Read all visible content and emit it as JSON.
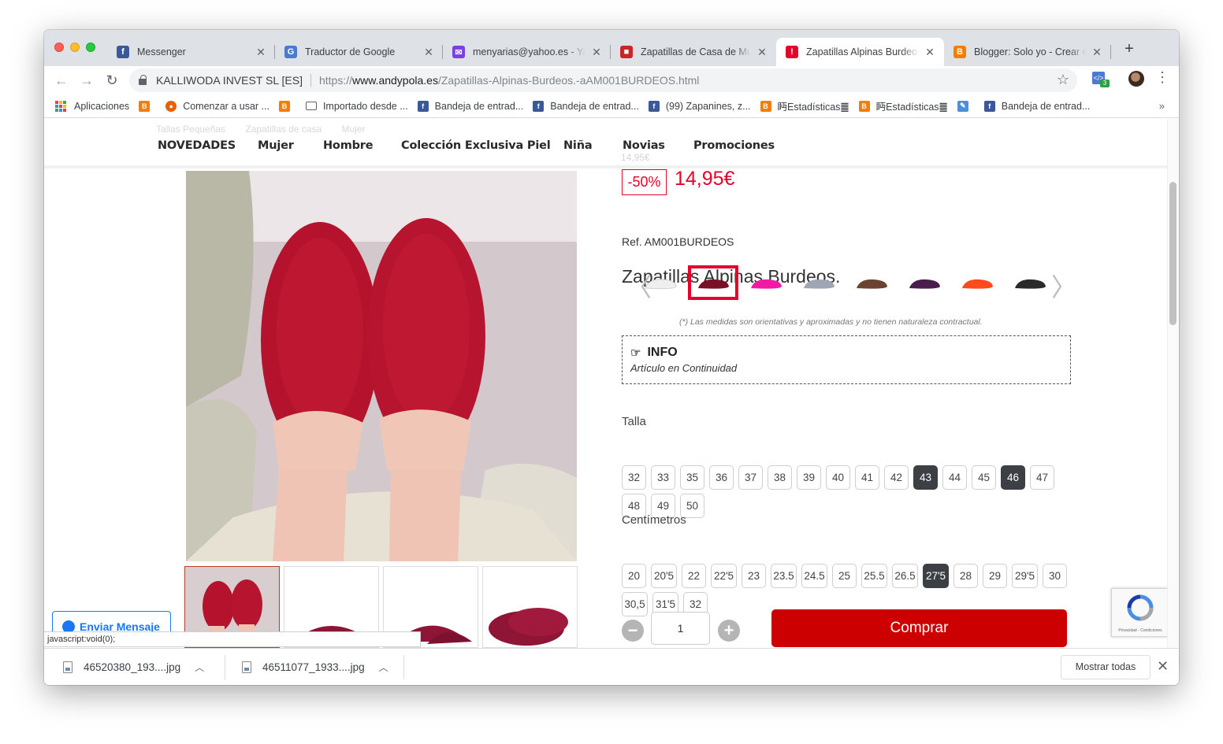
{
  "browser": {
    "tabs": [
      {
        "title": "Messenger",
        "favicon": "facebook-icon",
        "color": "#3b5998",
        "glyph": "f"
      },
      {
        "title": "Traductor de Google",
        "favicon": "google-translate-icon",
        "color": "#4a7bd0",
        "glyph": "G"
      },
      {
        "title": "menyarias@yahoo.es - Yahoo",
        "favicon": "yahoo-mail-icon",
        "color": "#7b3fe4",
        "glyph": "✉"
      },
      {
        "title": "Zapatillas de Casa de Mujer",
        "favicon": "store-icon",
        "color": "#c62828",
        "glyph": "■"
      },
      {
        "title": "Zapatillas Alpinas Burdeos",
        "favicon": "andypola-icon",
        "color": "#e4002b",
        "glyph": "!"
      },
      {
        "title": "Blogger: Solo yo - Crear en",
        "favicon": "blogger-icon",
        "color": "#f57d00",
        "glyph": "B"
      }
    ],
    "address": {
      "org": "KALLIWODA INVEST SL [ES]",
      "scheme": "https://",
      "host": "www.andypola.es",
      "path": "/Zapatillas-Alpinas-Burdeos.-aAM001BURDEOS.html"
    },
    "extension_badge": "3",
    "bookmarks": [
      {
        "label": "Aplicaciones",
        "icon": "apps-grid-icon"
      },
      {
        "label": "",
        "icon": "blogger-icon",
        "color": "#f57d00",
        "glyph": "B"
      },
      {
        "label": "Comenzar a usar ...",
        "icon": "firefox-icon",
        "color": "#e66000",
        "glyph": "●"
      },
      {
        "label": "",
        "icon": "blogger-icon",
        "color": "#f57d00",
        "glyph": "B"
      },
      {
        "label": "Importado desde ...",
        "icon": "folder-icon",
        "color": "#ffffff",
        "glyph": ""
      },
      {
        "label": "Bandeja de entrad...",
        "icon": "facebook-icon",
        "color": "#3b5998",
        "glyph": "f"
      },
      {
        "label": "Bandeja de entrad...",
        "icon": "facebook-icon",
        "color": "#3b5998",
        "glyph": "f"
      },
      {
        "label": "(99) Zapanines, z...",
        "icon": "facebook-icon",
        "color": "#3b5998",
        "glyph": "f"
      },
      {
        "label": "眄Estadísticas䷀",
        "icon": "blogger-icon",
        "color": "#f57d00",
        "glyph": "B"
      },
      {
        "label": "眄Estadísticas䷀",
        "icon": "blogger-icon",
        "color": "#f57d00",
        "glyph": "B"
      },
      {
        "label": "",
        "icon": "bookmark-script-icon",
        "color": "#4a90d9",
        "glyph": "✎"
      },
      {
        "label": "Bandeja de entrad...",
        "icon": "facebook-icon",
        "color": "#3b5998",
        "glyph": "f"
      }
    ],
    "status_url": "javascript:void(0);",
    "downloads": [
      {
        "file": "46520380_193....jpg"
      },
      {
        "file": "46511077_1933....jpg"
      }
    ],
    "show_all": "Mostrar todas"
  },
  "site": {
    "ghost_breadcrumb": [
      "Tallas Pequeñas",
      "Zapatillas de casa",
      "Mujer"
    ],
    "nav": [
      "NOVEDADES",
      "Mujer",
      "Hombre",
      "Colección Exclusiva Piel",
      "Niña",
      "Novias",
      "Promociones"
    ],
    "ghost_price_label": "14,95€"
  },
  "product": {
    "discount": "-50%",
    "price": "14,95€",
    "ref": "Ref. AM001BURDEOS",
    "title": "Zapatillas Alpinas Burdeos.",
    "colors": [
      {
        "name": "white-slipper",
        "color": "#efefef",
        "selected": false
      },
      {
        "name": "burgundy-slipper",
        "color": "#7a1028",
        "selected": true
      },
      {
        "name": "pink-slipper",
        "color": "#f01aa4",
        "selected": false
      },
      {
        "name": "grey-slipper",
        "color": "#9ea6b4",
        "selected": false
      },
      {
        "name": "brown-slipper",
        "color": "#6b4330",
        "selected": false
      },
      {
        "name": "purple-slipper",
        "color": "#4b1d4f",
        "selected": false
      },
      {
        "name": "orange-slipper",
        "color": "#ff4a1c",
        "selected": false
      },
      {
        "name": "black-slipper",
        "color": "#2a2a2a",
        "selected": false
      }
    ],
    "note": "(*) Las medidas son orientativas y aproximadas y no tienen naturaleza contractual.",
    "info_title": "INFO",
    "info_text": "Artículo en Continuidad",
    "size_label": "Talla",
    "sizes": [
      "32",
      "33",
      "35",
      "36",
      "37",
      "38",
      "39",
      "40",
      "41",
      "42",
      "43",
      "44",
      "45",
      "46",
      "47",
      "48",
      "49",
      "50"
    ],
    "sizes_dark": [
      "43",
      "46"
    ],
    "cm_label": "Centímetros",
    "cms": [
      "20",
      "20'5",
      "22",
      "22'5",
      "23",
      "23.5",
      "24.5",
      "25",
      "25.5",
      "26.5",
      "27'5",
      "28",
      "29",
      "29'5",
      "30",
      "30,5",
      "31'5",
      "32"
    ],
    "cms_dark": [
      "27'5"
    ],
    "quantity": "1",
    "buy_label": "Comprar"
  },
  "widgets": {
    "messenger_label": "Enviar Mensaje",
    "recaptcha_label": "Privacidad - Condiciones"
  }
}
